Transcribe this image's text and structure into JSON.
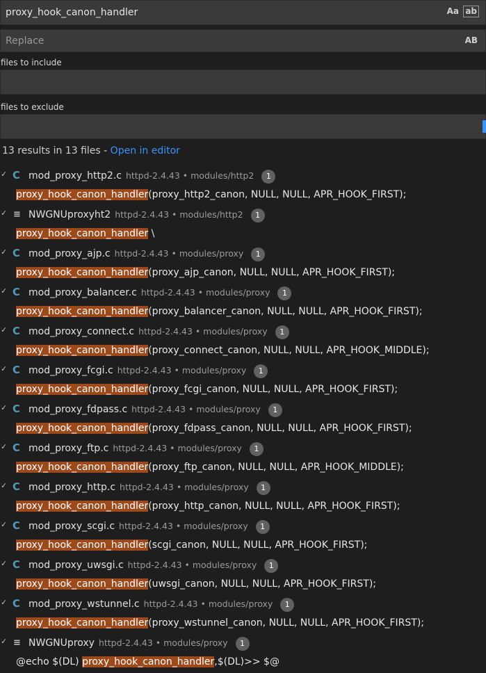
{
  "search": {
    "value": "proxy_hook_canon_handler",
    "match_case_label": "Aa",
    "whole_word_label": "ab"
  },
  "replace": {
    "placeholder": "Replace",
    "preserve_case_label": "AB"
  },
  "include": {
    "label": "files to include",
    "value": ""
  },
  "exclude": {
    "label": "files to exclude",
    "value": ""
  },
  "summary": {
    "text": "13 results in 13 files - ",
    "open_link": "Open in editor"
  },
  "results": [
    {
      "icon": "C",
      "name": "mod_proxy_http2.c",
      "path": "httpd-2.4.43 • modules/http2",
      "count": "1",
      "match": "proxy_hook_canon_handler",
      "pre": "",
      "post": "(proxy_http2_canon, NULL, NULL, APR_HOOK_FIRST);"
    },
    {
      "icon": "≡",
      "name": "NWGNUproxyht2",
      "path": "httpd-2.4.43 • modules/http2",
      "count": "1",
      "match": "proxy_hook_canon_handler",
      "pre": "",
      "post": " \\"
    },
    {
      "icon": "C",
      "name": "mod_proxy_ajp.c",
      "path": "httpd-2.4.43 • modules/proxy",
      "count": "1",
      "match": "proxy_hook_canon_handler",
      "pre": "",
      "post": "(proxy_ajp_canon, NULL, NULL, APR_HOOK_FIRST);"
    },
    {
      "icon": "C",
      "name": "mod_proxy_balancer.c",
      "path": "httpd-2.4.43 • modules/proxy",
      "count": "1",
      "match": "proxy_hook_canon_handler",
      "pre": "",
      "post": "(proxy_balancer_canon, NULL, NULL, APR_HOOK_FIRST);"
    },
    {
      "icon": "C",
      "name": "mod_proxy_connect.c",
      "path": "httpd-2.4.43 • modules/proxy",
      "count": "1",
      "match": "proxy_hook_canon_handler",
      "pre": "",
      "post": "(proxy_connect_canon, NULL, NULL, APR_HOOK_MIDDLE);"
    },
    {
      "icon": "C",
      "name": "mod_proxy_fcgi.c",
      "path": "httpd-2.4.43 • modules/proxy",
      "count": "1",
      "match": "proxy_hook_canon_handler",
      "pre": "",
      "post": "(proxy_fcgi_canon, NULL, NULL, APR_HOOK_FIRST);"
    },
    {
      "icon": "C",
      "name": "mod_proxy_fdpass.c",
      "path": "httpd-2.4.43 • modules/proxy",
      "count": "1",
      "match": "proxy_hook_canon_handler",
      "pre": "",
      "post": "(proxy_fdpass_canon, NULL, NULL, APR_HOOK_FIRST);"
    },
    {
      "icon": "C",
      "name": "mod_proxy_ftp.c",
      "path": "httpd-2.4.43 • modules/proxy",
      "count": "1",
      "match": "proxy_hook_canon_handler",
      "pre": "",
      "post": "(proxy_ftp_canon, NULL, NULL, APR_HOOK_MIDDLE);"
    },
    {
      "icon": "C",
      "name": "mod_proxy_http.c",
      "path": "httpd-2.4.43 • modules/proxy",
      "count": "1",
      "match": "proxy_hook_canon_handler",
      "pre": "",
      "post": "(proxy_http_canon, NULL, NULL, APR_HOOK_FIRST);"
    },
    {
      "icon": "C",
      "name": "mod_proxy_scgi.c",
      "path": "httpd-2.4.43 • modules/proxy",
      "count": "1",
      "match": "proxy_hook_canon_handler",
      "pre": "",
      "post": "(scgi_canon, NULL, NULL, APR_HOOK_FIRST);"
    },
    {
      "icon": "C",
      "name": "mod_proxy_uwsgi.c",
      "path": "httpd-2.4.43 • modules/proxy",
      "count": "1",
      "match": "proxy_hook_canon_handler",
      "pre": "",
      "post": "(uwsgi_canon, NULL, NULL, APR_HOOK_FIRST);"
    },
    {
      "icon": "C",
      "name": "mod_proxy_wstunnel.c",
      "path": "httpd-2.4.43 • modules/proxy",
      "count": "1",
      "match": "proxy_hook_canon_handler",
      "pre": "",
      "post": "(proxy_wstunnel_canon, NULL, NULL, APR_HOOK_FIRST);"
    },
    {
      "icon": "≡",
      "name": "NWGNUproxy",
      "path": "httpd-2.4.43 • modules/proxy",
      "count": "1",
      "match": "proxy_hook_canon_handler",
      "pre": "@echo $(DL) ",
      "post": ",$(DL)>> $@"
    }
  ],
  "colors": {
    "background": "#1e1e1e",
    "input_bg": "#3a3a3a",
    "highlight": "#9c4a1b",
    "link": "#3794ff",
    "c_icon": "#519aba"
  }
}
